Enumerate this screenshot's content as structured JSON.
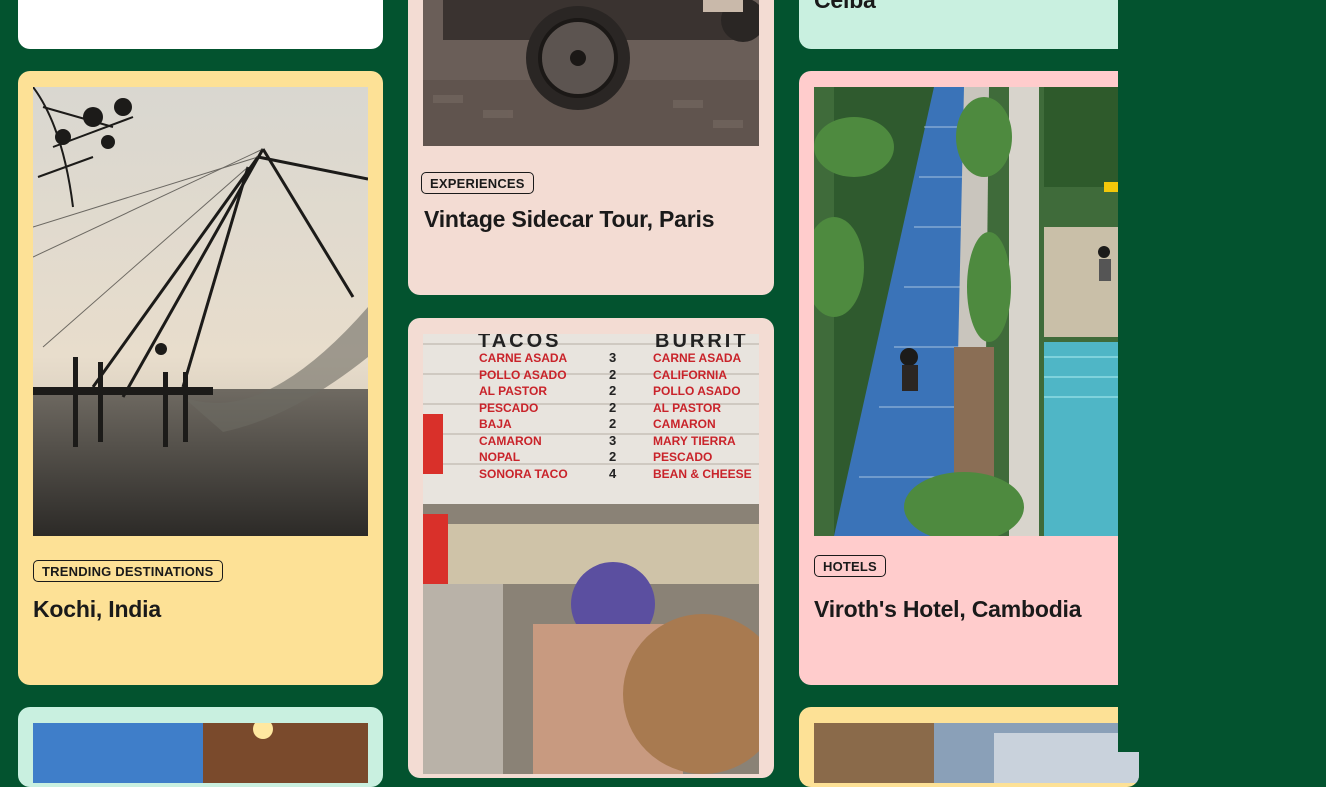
{
  "cards": {
    "top_left": {
      "title": ""
    },
    "kochi": {
      "tag": "Trending Destinations",
      "title": "Kochi, India"
    },
    "sidecar": {
      "tag": "Experiences",
      "title": "Vintage Sidecar Tour, Paris"
    },
    "tacos": {
      "menu_left_header": "TACOS",
      "menu_right_header": "BURRIT",
      "menu_left_items": [
        "CARNE ASADA",
        "POLLO ASADO",
        "AL PASTOR",
        "PESCADO",
        "BAJA",
        "CAMARON",
        "NOPAL",
        "SONORA TACO"
      ],
      "menu_right_items": [
        "CARNE ASADA",
        "CALIFORNIA",
        "POLLO ASADO",
        "AL PASTOR",
        "CAMARON",
        "MARY TIERRA",
        "PESCADO",
        "BEAN & CHEESE"
      ],
      "menu_prices": [
        "3",
        "2",
        "2",
        "2",
        "2",
        "3",
        "2",
        "4"
      ]
    },
    "ceiba": {
      "title": "Ceiba"
    },
    "viroth": {
      "tag": "Hotels",
      "title": "Viroth's Hotel, Cambodia"
    }
  },
  "colors": {
    "background": "#03532f",
    "card_yellow": "#fde196",
    "card_peach": "#f3dcd3",
    "card_mint": "#c9f0e0",
    "card_pink": "#ffcccc",
    "card_white": "#ffffff"
  }
}
